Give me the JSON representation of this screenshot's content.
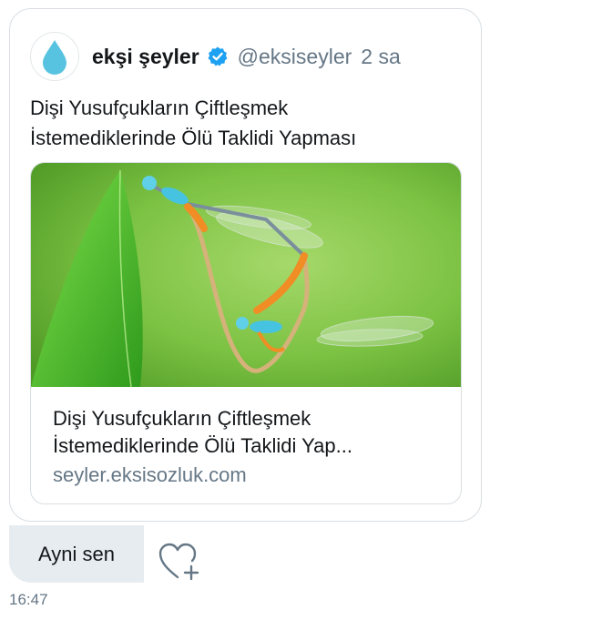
{
  "tweet": {
    "author_name": "ekşi şeyler",
    "handle": "@eksiseyler",
    "time": "2 sa",
    "text_line1": "Dişi Yusufçukların Çiftleşmek",
    "text_line2": "İstemediklerinde Ölü Taklidi Yapması"
  },
  "link_card": {
    "title_line1": "Dişi Yusufçukların Çiftleşmek",
    "title_line2": "İstemediklerinde Ölü Taklidi Yap...",
    "domain": "seyler.eksisozluk.com"
  },
  "reply": {
    "text": "Ayni sen"
  },
  "message": {
    "timestamp": "16:47"
  },
  "icons": {
    "avatar": "water-drop-icon",
    "verified": "verified-badge-icon",
    "react": "heart-plus-icon"
  },
  "colors": {
    "brand_drop": "#58c3e0",
    "verified_blue": "#1da1f2",
    "muted_text": "#657786",
    "bubble_bg": "#e6ecf0"
  }
}
